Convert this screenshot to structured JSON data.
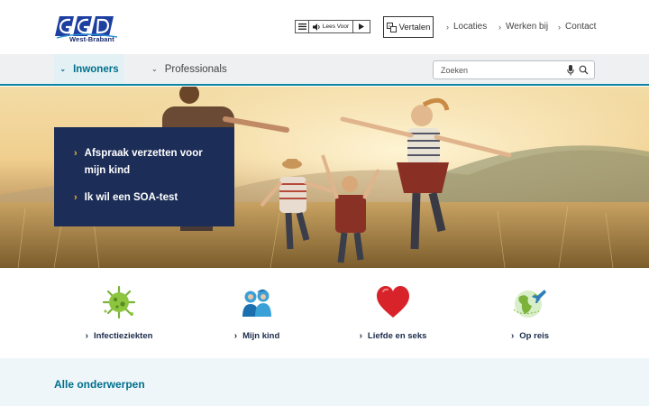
{
  "brand": {
    "logo_text": "GGD",
    "sub": "West-Brabant"
  },
  "colors": {
    "navy": "#1c2d57",
    "teal": "#006f8c",
    "accent": "#f2b52a",
    "nav_bg": "#eef0f2"
  },
  "header": {
    "lees_voor": "Lees Voor",
    "vertalen": "Vertalen",
    "links": [
      "Locaties",
      "Werken bij",
      "Contact"
    ]
  },
  "nav": {
    "tabs": [
      {
        "label": "Inwoners",
        "active": true
      },
      {
        "label": "Professionals",
        "active": false
      }
    ],
    "search_placeholder": "Zoeken"
  },
  "hero": {
    "links": [
      "Afspraak verzetten voor mijn kind",
      "Ik wil een SOA-test"
    ]
  },
  "categories": [
    {
      "label": "Infectieziekten",
      "icon": "virus-icon"
    },
    {
      "label": "Mijn kind",
      "icon": "children-icon"
    },
    {
      "label": "Liefde en seks",
      "icon": "heart-icon"
    },
    {
      "label": "Op reis",
      "icon": "globe-plane-icon"
    }
  ],
  "section": {
    "title": "Alle onderwerpen"
  }
}
